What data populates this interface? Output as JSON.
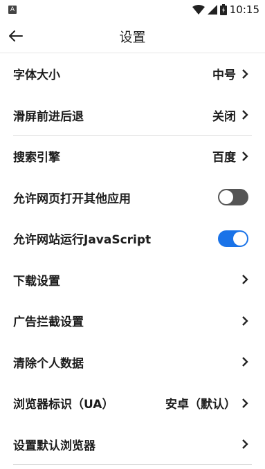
{
  "status_bar": {
    "time": "10:15",
    "notification_icon": "android-notification-icon"
  },
  "app_bar": {
    "title": "设置",
    "back_icon": "arrow-left-icon"
  },
  "settings": [
    {
      "label": "字体大小",
      "value": "中号"
    },
    {
      "label": "滑屏前进后退",
      "value": "关闭"
    },
    {
      "label": "搜索引擎",
      "value": "百度"
    },
    {
      "label": "允许网页打开其他应用",
      "toggle": false
    },
    {
      "label": "允许网站运行JavaScript",
      "toggle": true
    },
    {
      "label": "下载设置",
      "value": ""
    },
    {
      "label": "广告拦截设置",
      "value": ""
    },
    {
      "label": "清除个人数据",
      "value": ""
    },
    {
      "label": "浏览器标识（UA）",
      "value": "安卓（默认）"
    },
    {
      "label": "设置默认浏览器",
      "value": ""
    }
  ],
  "colors": {
    "toggle_on": "#1a73e8",
    "toggle_off": "#555555"
  }
}
